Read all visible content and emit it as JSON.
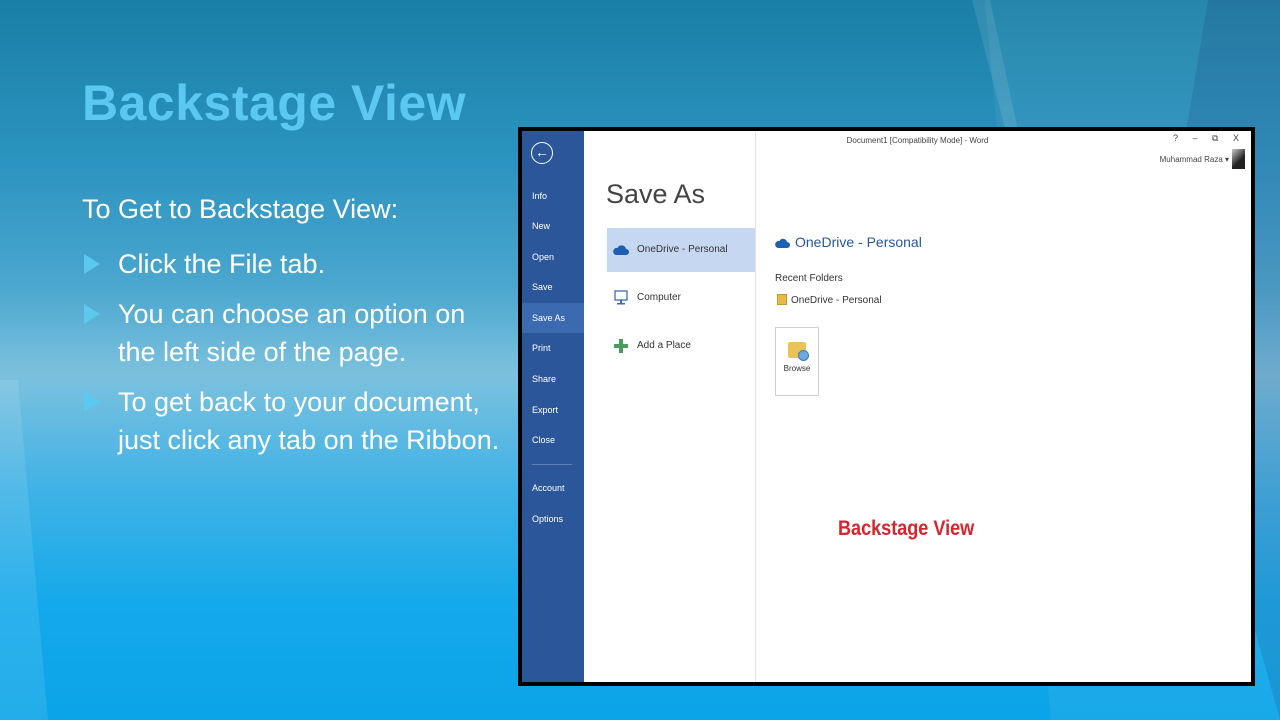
{
  "slide": {
    "title": "Backstage View",
    "intro": "To Get to Backstage View:",
    "bullets": [
      "Click the File tab.",
      "You can choose an option on the left side of the page.",
      "To get back to your document, just click any tab on the Ribbon."
    ],
    "colors": {
      "title": "#5bc8f0",
      "bullet": "#5bc8f0",
      "text": "#ffffff"
    }
  },
  "word": {
    "window_title": "Document1 [Compatibility Mode] - Word",
    "window_controls": "? – ⧉ X",
    "user_name": "Muhammad Raza ▾",
    "back_icon": "back-arrow-icon",
    "nav": {
      "items": [
        "Info",
        "New",
        "Open",
        "Save",
        "Save As",
        "Print",
        "Share",
        "Export",
        "Close",
        "Account",
        "Options"
      ],
      "active": "Save As",
      "color": "#2b579a"
    },
    "heading": "Save As",
    "places": [
      {
        "label": "OneDrive - Personal",
        "icon": "onedrive-cloud-icon",
        "active": true
      },
      {
        "label": "Computer",
        "icon": "computer-icon",
        "active": false
      },
      {
        "label": "Add a Place",
        "icon": "add-plus-icon",
        "active": false
      }
    ],
    "detail": {
      "title": "OneDrive - Personal",
      "recent_label": "Recent Folders",
      "recent_item": "OneDrive - Personal",
      "browse_label": "Browse"
    },
    "annotation": {
      "text": "Backstage View",
      "color": "#d9232d"
    }
  }
}
